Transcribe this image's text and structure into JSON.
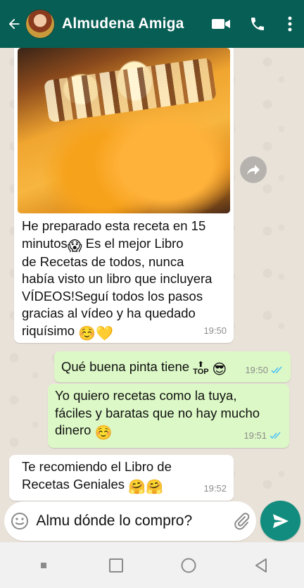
{
  "header": {
    "contact_name": "Almudena Amiga",
    "back_icon": "arrow-left-icon",
    "video_icon": "video-camera-icon",
    "call_icon": "phone-icon",
    "menu_icon": "more-vert-icon",
    "color": "#075e54"
  },
  "messages": [
    {
      "direction": "incoming",
      "type": "image",
      "caption_lines": [
        "He preparado esta receta en 15",
        "minutos",
        "Es el mejor Libro",
        "de Recetas de todos, nunca",
        "había visto un libro que incluyera",
        "VÍDEOS!Seguí todos los pasos",
        "gracias al vídeo y ha quedado",
        "riquísimo"
      ],
      "time": "19:50"
    },
    {
      "direction": "outgoing",
      "text": "Qué buena pinta tiene",
      "time": "19:50",
      "top_label": "TOP",
      "status": "read"
    },
    {
      "direction": "outgoing",
      "lines": [
        "Yo quiero recetas como la tuya,",
        "fáciles y baratas que no hay mucho",
        "dinero"
      ],
      "time": "19:51",
      "status": "read"
    },
    {
      "direction": "incoming",
      "lines": [
        "Te recomiendo el Libro de",
        "Recetas Geniales"
      ],
      "time": "19:52"
    }
  ],
  "composer": {
    "value": "Almu dónde lo compro?",
    "emoji_icon": "smiley-icon",
    "attach_icon": "paperclip-icon",
    "send_icon": "send-icon"
  },
  "colors": {
    "incoming": "#ffffff",
    "outgoing": "#dcf8c6",
    "send_button": "#128c7e",
    "read_ticks": "#4fc3f7"
  }
}
